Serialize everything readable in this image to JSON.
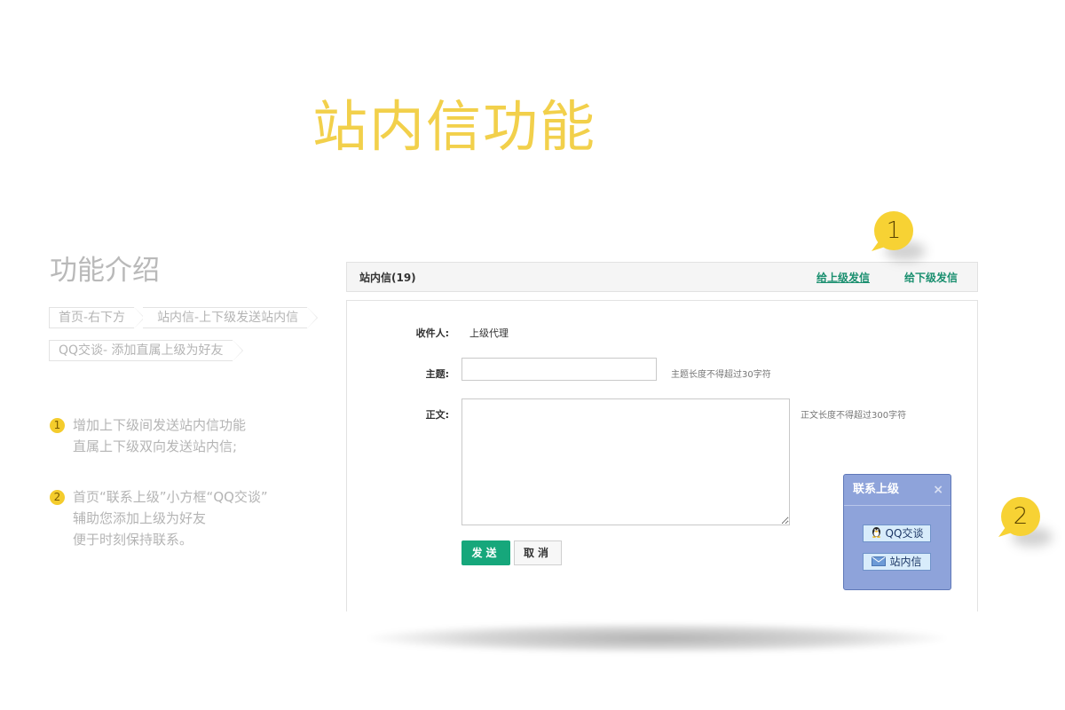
{
  "hero": {
    "title": "站内信功能"
  },
  "intro": {
    "title": "功能介绍",
    "breadcrumbs": [
      [
        "首页-右下方",
        "站内信-上下级发送站内信"
      ],
      [
        "QQ交谈- 添加直属上级为好友"
      ]
    ],
    "features": [
      {
        "num": "1",
        "lines": [
          "增加上下级间发送站内信功能",
          "直属上下级双向发送站内信;"
        ]
      },
      {
        "num": "2",
        "lines": [
          "首页“联系上级”小方框“QQ交谈”",
          "辅助您添加上级为好友",
          "便于时刻保持联系。"
        ]
      }
    ]
  },
  "window": {
    "title": "站内信(19)",
    "link_up": "给上级发信",
    "link_down": "给下级发信",
    "form": {
      "recipient_label": "收件人:",
      "recipient_value": "上级代理",
      "subject_label": "主题:",
      "subject_value": "",
      "subject_hint": "主题长度不得超过30字符",
      "body_label": "正文:",
      "body_value": "",
      "body_hint": "正文长度不得超过300字符",
      "send_label": "发送",
      "cancel_label": "取消"
    }
  },
  "popup": {
    "title": "联系上级",
    "close": "×",
    "qq_label": "QQ交谈",
    "mail_label": "站内信"
  },
  "callouts": [
    "1",
    "2"
  ],
  "colors": {
    "accent_yellow": "#f7d234",
    "green": "#16a77b",
    "popup_blue": "#8ea3da"
  }
}
